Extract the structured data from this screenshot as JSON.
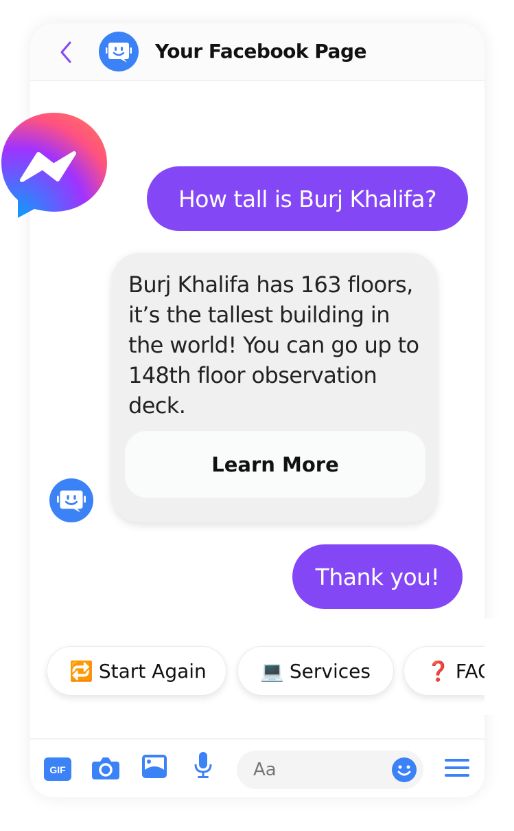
{
  "header": {
    "title": "Your Facebook Page",
    "back_icon": "chevron-left-icon",
    "avatar_icon": "bot-avatar-icon"
  },
  "brand": {
    "logo": "messenger-logo-icon",
    "accent": "#8447f6",
    "blue": "#3b82f6"
  },
  "messages": [
    {
      "from": "user",
      "text": "How tall is Burj Khalifa?"
    },
    {
      "from": "bot",
      "text": "Burj Khalifa has 163 floors, it’s the tallest building in the world! You can go up to 148th floor observation deck.",
      "button": "Learn More"
    },
    {
      "from": "user",
      "text": "Thank you!"
    }
  ],
  "quick_replies": [
    {
      "emoji": "🔁",
      "label": "Start Again"
    },
    {
      "emoji": "💻",
      "label": "Services"
    },
    {
      "emoji": "❓",
      "label": "FAQ"
    }
  ],
  "composer": {
    "placeholder": "Aa",
    "icons": [
      "gif-icon",
      "camera-icon",
      "image-icon",
      "microphone-icon",
      "emoji-icon",
      "menu-icon"
    ]
  }
}
